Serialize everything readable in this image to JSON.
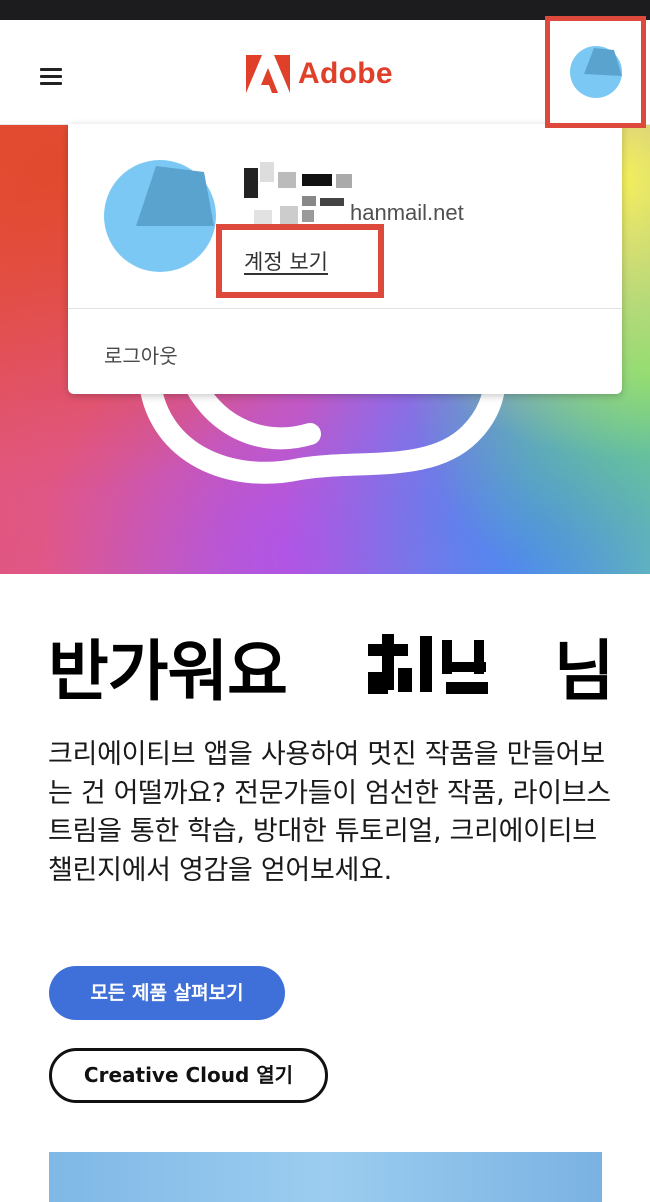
{
  "header": {
    "brand_name": "Adobe",
    "brand_color": "#e0402a",
    "menu_icon": "hamburger-menu-icon",
    "avatar_icon": "user-avatar-icon",
    "highlight_color": "#dd4a3b"
  },
  "account_menu": {
    "email_visible_part": "hanmail.net",
    "view_account_label": "계정 보기",
    "logout_label": "로그아웃"
  },
  "main": {
    "greeting_prefix": "반가워요",
    "greeting_suffix": "님",
    "description": "크리에이티브 앱을 사용하여 멋진 작품을 만들어보는 건 어떨까요? 전문가들이 엄선한 작품, 라이브스트림을 통한 학습, 방대한 튜토리얼, 크리에이티브 챌린지에서 영감을 얻어보세요.",
    "primary_button_label": "모든 제품 살펴보기",
    "secondary_button_label": "Creative Cloud 열기",
    "primary_button_color": "#3f6fd8"
  }
}
